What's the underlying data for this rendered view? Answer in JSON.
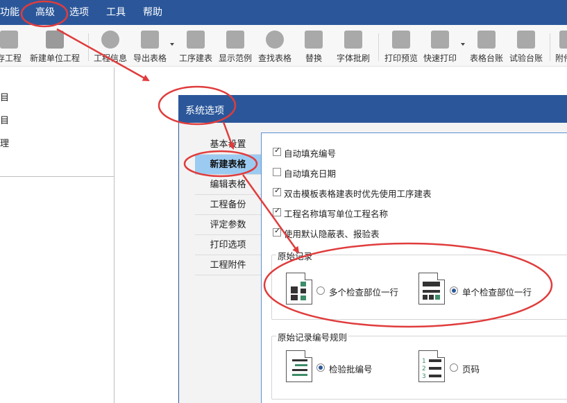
{
  "menubar": {
    "items": [
      {
        "label": "功能"
      },
      {
        "label": "高级"
      },
      {
        "label": "选项"
      },
      {
        "label": "工具"
      },
      {
        "label": "帮助"
      }
    ]
  },
  "toolbar": {
    "items": [
      {
        "label": "存工程",
        "icon": "save-project-icon"
      },
      {
        "label": "新建单位工程",
        "icon": "new-unit-project-icon"
      },
      {
        "label": "工程信息",
        "icon": "info-icon"
      },
      {
        "label": "导出表格",
        "icon": "export-table-icon"
      },
      {
        "label": "工序建表",
        "icon": "layers-icon"
      },
      {
        "label": "显示范例",
        "icon": "example-icon"
      },
      {
        "label": "查找表格",
        "icon": "search-icon"
      },
      {
        "label": "替换",
        "icon": "replace-icon"
      },
      {
        "label": "字体批刷",
        "icon": "font-brush-icon"
      },
      {
        "label": "打印预览",
        "icon": "eye-icon"
      },
      {
        "label": "快速打印",
        "icon": "printer-icon"
      },
      {
        "label": "表格台账",
        "icon": "table-ledger-icon"
      },
      {
        "label": "试验台账",
        "icon": "test-ledger-icon"
      },
      {
        "label": "附件",
        "icon": "attachment-icon"
      }
    ]
  },
  "left_panel": {
    "rows": [
      {
        "label": "目"
      },
      {
        "label": "目"
      },
      {
        "label": "理"
      }
    ]
  },
  "dialog": {
    "title": "系统选项",
    "nav": [
      {
        "label": "基本设置",
        "active": false
      },
      {
        "label": "新建表格",
        "active": true
      },
      {
        "label": "编辑表格",
        "active": false
      },
      {
        "label": "工程备份",
        "active": false
      },
      {
        "label": "评定参数",
        "active": false
      },
      {
        "label": "打印选项",
        "active": false
      },
      {
        "label": "工程附件",
        "active": false
      }
    ],
    "checkboxes": [
      {
        "label": "自动填充编号",
        "checked": true
      },
      {
        "label": "自动填充日期",
        "checked": false
      },
      {
        "label": "双击模板表格建表时优先使用工序建表",
        "checked": true
      },
      {
        "label": "工程名称填写单位工程名称",
        "checked": true
      },
      {
        "label": "使用默认隐蔽表、报验表",
        "checked": true
      }
    ],
    "group_original_record": {
      "title": "原始记录",
      "options": [
        {
          "label": "多个检查部位一行",
          "selected": false
        },
        {
          "label": "单个检查部位一行",
          "selected": true
        }
      ]
    },
    "group_numbering_rule": {
      "title": "原始记录编号规则",
      "options": [
        {
          "label": "检验批编号",
          "selected": true
        },
        {
          "label": "页码",
          "selected": false
        }
      ],
      "page_numbers": [
        "1",
        "2",
        "3"
      ]
    }
  },
  "colors": {
    "menubar_bg": "#2b579a",
    "nav_active_bg": "#9ccbf2",
    "annotation_red": "#e03c3c",
    "icon_green": "#3d8d68"
  }
}
